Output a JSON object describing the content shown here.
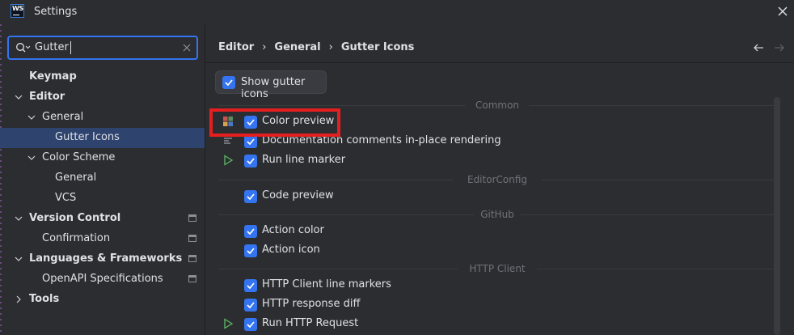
{
  "window": {
    "title": "Settings",
    "app_logo_text": "WS"
  },
  "search": {
    "value": "Gutter"
  },
  "sidebar": {
    "items": [
      {
        "label": "Keymap"
      },
      {
        "label": "Editor"
      },
      {
        "label": "General"
      },
      {
        "label": "Gutter Icons"
      },
      {
        "label": "Color Scheme"
      },
      {
        "label": "General"
      },
      {
        "label": "VCS"
      },
      {
        "label": "Version Control"
      },
      {
        "label": "Confirmation"
      },
      {
        "label": "Languages & Frameworks"
      },
      {
        "label": "OpenAPI Specifications"
      },
      {
        "label": "Tools"
      }
    ],
    "selected": "Gutter Icons"
  },
  "breadcrumb": {
    "items": [
      "Editor",
      "General",
      "Gutter Icons"
    ]
  },
  "main": {
    "show_gutter": {
      "label": "Show gutter icons",
      "checked": true
    },
    "groups": [
      {
        "title": "Common"
      },
      {
        "title": "EditorConfig"
      },
      {
        "title": "GitHub"
      },
      {
        "title": "HTTP Client"
      }
    ],
    "rows": [
      {
        "label": "Color preview",
        "checked": true,
        "icon": "color-grid-icon"
      },
      {
        "label": "Documentation comments in-place rendering",
        "checked": true,
        "icon": "doc-lines-icon"
      },
      {
        "label": "Run line marker",
        "checked": true,
        "icon": "run-icon"
      },
      {
        "label": "Code preview",
        "checked": true
      },
      {
        "label": "Action color",
        "checked": true
      },
      {
        "label": "Action icon",
        "checked": true
      },
      {
        "label": "HTTP Client line markers",
        "checked": true
      },
      {
        "label": "HTTP response diff",
        "checked": true
      },
      {
        "label": "Run HTTP Request",
        "checked": true,
        "icon": "run-icon"
      }
    ]
  },
  "colors": {
    "accent": "#3574f0",
    "selection": "#2e436e",
    "highlight": "#e51f1f",
    "run_green": "#5fb865"
  }
}
